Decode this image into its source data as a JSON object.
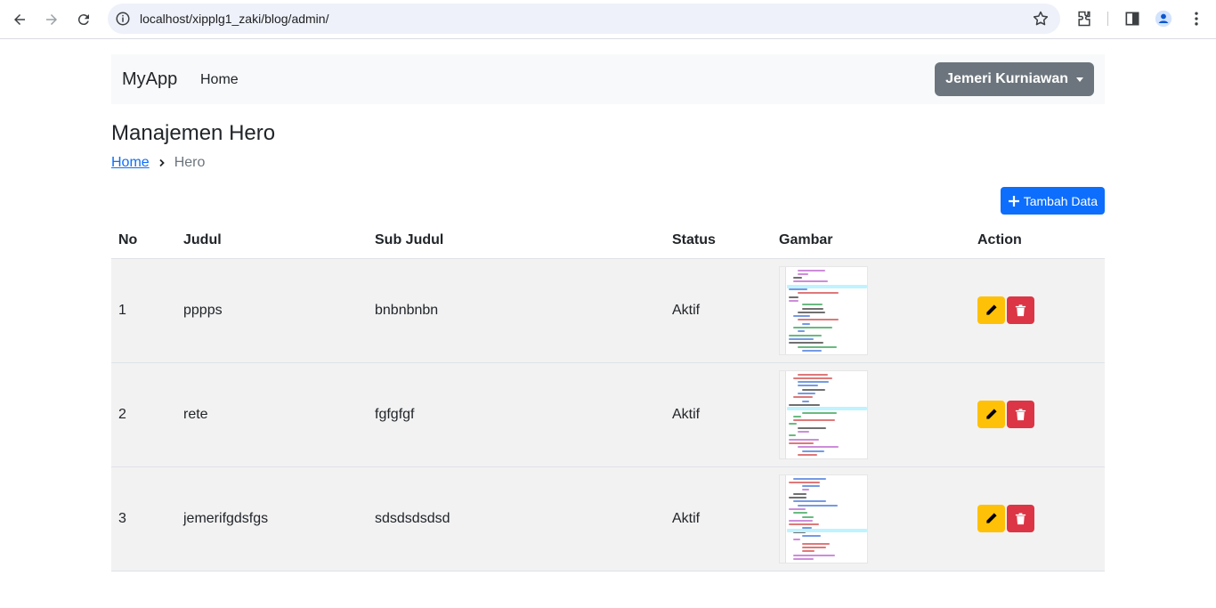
{
  "browser": {
    "url": "localhost/xipplg1_zaki/blog/admin/"
  },
  "navbar": {
    "brand": "MyApp",
    "home_link": "Home",
    "user_name": "Jemeri Kurniawan"
  },
  "page": {
    "title": "Manajemen Hero",
    "breadcrumb": {
      "home": "Home",
      "current": "Hero"
    },
    "add_button": "Tambah Data"
  },
  "table": {
    "headers": [
      "No",
      "Judul",
      "Sub Judul",
      "Status",
      "Gambar",
      "Action"
    ],
    "rows": [
      {
        "no": "1",
        "judul": "pppps",
        "sub_judul": "bnbnbnbn",
        "status": "Aktif"
      },
      {
        "no": "2",
        "judul": "rete",
        "sub_judul": "fgfgfgf",
        "status": "Aktif"
      },
      {
        "no": "3",
        "judul": "jemerifgdsfgs",
        "sub_judul": "sdsdsdsdsd",
        "status": "Aktif"
      }
    ]
  },
  "colors": {
    "primary": "#0d6efd",
    "warning": "#ffc107",
    "danger": "#dc3545",
    "secondary": "#6c757d"
  }
}
